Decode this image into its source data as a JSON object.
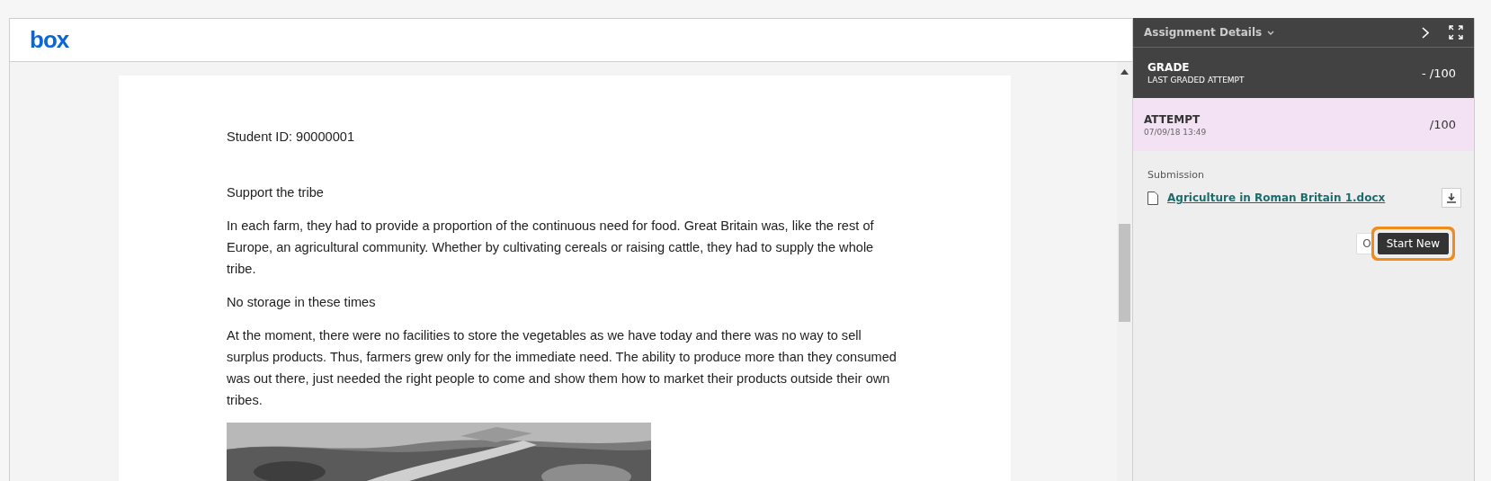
{
  "viewer": {
    "logo": "box",
    "document": {
      "paragraphs": [
        {
          "kind": "id",
          "text": "Student ID: 90000001"
        },
        {
          "kind": "heading",
          "text": "Support the tribe"
        },
        {
          "kind": "body",
          "text": "In each farm, they had to provide a proportion of the continuous need for food. Great Britain was, like the rest of Europe, an agricultural community. Whether by cultivating cereals or raising cattle, they had to supply the whole tribe."
        },
        {
          "kind": "heading",
          "text": "No storage in these times"
        },
        {
          "kind": "body",
          "text": "At the moment, there were no facilities to store the vegetables as we have today and there was no way to sell surplus products. Thus, farmers grew only for the immediate need. The ability to produce more than they consumed was out there, just needed the right people to come and show them how to market their products outside their own tribes."
        },
        {
          "kind": "picture"
        }
      ]
    }
  },
  "panel": {
    "title": "Assignment Details",
    "grade": {
      "label": "GRADE",
      "sublabel": "LAST GRADED ATTEMPT",
      "score": "-",
      "total": "/100"
    },
    "attempt": {
      "label": "ATTEMPT",
      "date": "07/09/18 13:49",
      "total": "/100",
      "selected": true
    },
    "submission": {
      "label": "Submission",
      "file": "Agriculture in Roman Britain 1.docx"
    },
    "buttons": [
      {
        "label": "O",
        "highlighted": false
      },
      {
        "label": "Start New",
        "highlighted": true
      }
    ]
  }
}
